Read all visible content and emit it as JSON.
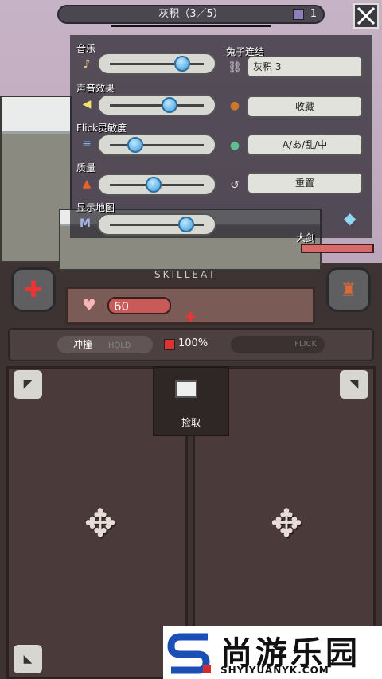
{
  "topbar": {
    "title": "灰积（3／5）",
    "counter": "1",
    "close_icon": "close-x-icon"
  },
  "settings": {
    "music_label": "音乐",
    "music_value": 0.75,
    "sfx_label": "声音效果",
    "sfx_value": 0.6,
    "flick_label": "Flick灵敏度",
    "flick_value": 0.2,
    "quality_label": "质量",
    "quality_value": 0.42,
    "minimap_label": "显示地图",
    "minimap_value": 0.8,
    "rabbit_link_label": "兔子连结",
    "rabbit_link_button": "灰积 3",
    "favorites_button": "收藏",
    "language_button": "A/あ/乱/中",
    "reset_button": "重置"
  },
  "game": {
    "skilleat_text": "SKILLEAT",
    "big_sword_label": "大剑",
    "hp_value": "60",
    "skill_left": "冲撞",
    "skill_hold": "HOLD",
    "percent": "100%",
    "flick": "FLICK",
    "pickup_label": "捡取"
  },
  "watermark": {
    "brand": "尚游乐园",
    "url": "SHYIYUANYK.COM"
  }
}
